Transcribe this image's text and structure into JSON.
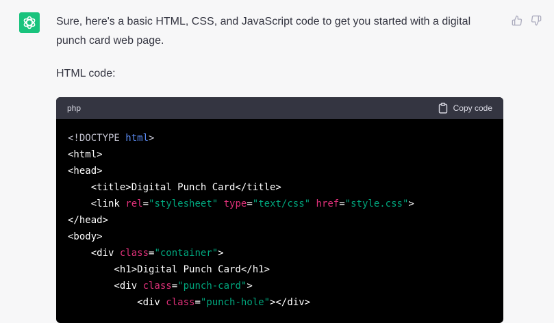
{
  "message": {
    "paragraph_1": "Sure, here's a basic HTML, CSS, and JavaScript code to get you started with a digital punch card web page.",
    "paragraph_2": "HTML code:"
  },
  "feedback": {
    "thumbs_up_icon": "thumbs-up-icon",
    "thumbs_down_icon": "thumbs-down-icon"
  },
  "avatar_icon": "openai-logo-icon",
  "code_block": {
    "language": "php",
    "copy_label": "Copy code",
    "lines": [
      [
        {
          "t": "<!DOCTYPE ",
          "c": "doc"
        },
        {
          "t": "html",
          "c": "kw"
        },
        {
          "t": ">",
          "c": "doc"
        }
      ],
      [
        {
          "t": "<html>",
          "c": "tag"
        }
      ],
      [
        {
          "t": "<head>",
          "c": "tag"
        }
      ],
      [
        {
          "t": "    <title>Digital Punch Card</title>",
          "c": "tag"
        }
      ],
      [
        {
          "t": "    <link ",
          "c": "tag"
        },
        {
          "t": "rel",
          "c": "attr"
        },
        {
          "t": "=",
          "c": "tag"
        },
        {
          "t": "\"stylesheet\"",
          "c": "str"
        },
        {
          "t": " ",
          "c": "tag"
        },
        {
          "t": "type",
          "c": "attr"
        },
        {
          "t": "=",
          "c": "tag"
        },
        {
          "t": "\"text/css\"",
          "c": "str"
        },
        {
          "t": " ",
          "c": "tag"
        },
        {
          "t": "href",
          "c": "attr"
        },
        {
          "t": "=",
          "c": "tag"
        },
        {
          "t": "\"style.css\"",
          "c": "str"
        },
        {
          "t": ">",
          "c": "tag"
        }
      ],
      [
        {
          "t": "</head>",
          "c": "tag"
        }
      ],
      [
        {
          "t": "<body>",
          "c": "tag"
        }
      ],
      [
        {
          "t": "    <div ",
          "c": "tag"
        },
        {
          "t": "class",
          "c": "attr"
        },
        {
          "t": "=",
          "c": "tag"
        },
        {
          "t": "\"container\"",
          "c": "str"
        },
        {
          "t": ">",
          "c": "tag"
        }
      ],
      [
        {
          "t": "        <h1>Digital Punch Card</h1>",
          "c": "tag"
        }
      ],
      [
        {
          "t": "        <div ",
          "c": "tag"
        },
        {
          "t": "class",
          "c": "attr"
        },
        {
          "t": "=",
          "c": "tag"
        },
        {
          "t": "\"punch-card\"",
          "c": "str"
        },
        {
          "t": ">",
          "c": "tag"
        }
      ],
      [
        {
          "t": "            <div ",
          "c": "tag"
        },
        {
          "t": "class",
          "c": "attr"
        },
        {
          "t": "=",
          "c": "tag"
        },
        {
          "t": "\"punch-hole\"",
          "c": "str"
        },
        {
          "t": "></div>",
          "c": "tag"
        }
      ]
    ]
  }
}
